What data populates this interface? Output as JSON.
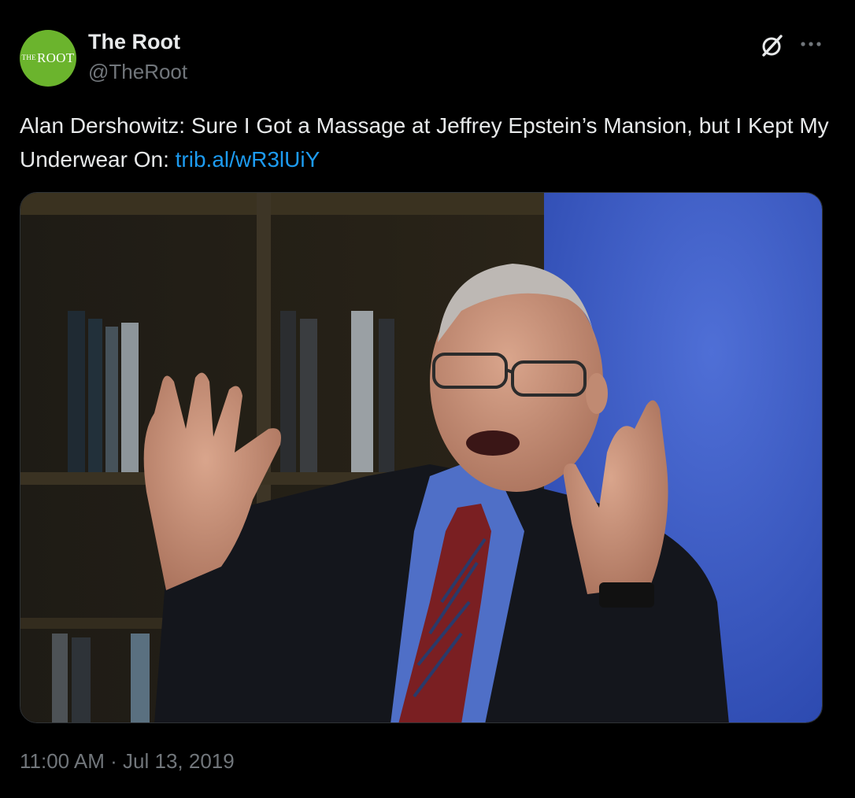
{
  "author": {
    "name": "The Root",
    "handle": "@TheRoot",
    "avatar_text_small": "THE",
    "avatar_text_large": "ROOT",
    "avatar_color": "#6bb42d"
  },
  "tweet": {
    "text": "Alan Dershowitz: Sure I Got a Massage at Jeffrey Epstein’s Mansion, but I Kept My Underwear On: ",
    "link": "trib.al/wR3lUiY",
    "link_color": "#1d9bf0"
  },
  "media": {
    "icon": "photo-of-man-gesturing"
  },
  "timestamp": {
    "time": "11:00 AM",
    "separator": " · ",
    "date": "Jul 13, 2019"
  },
  "icons": {
    "grok": "grok-icon",
    "more": "more-icon"
  }
}
